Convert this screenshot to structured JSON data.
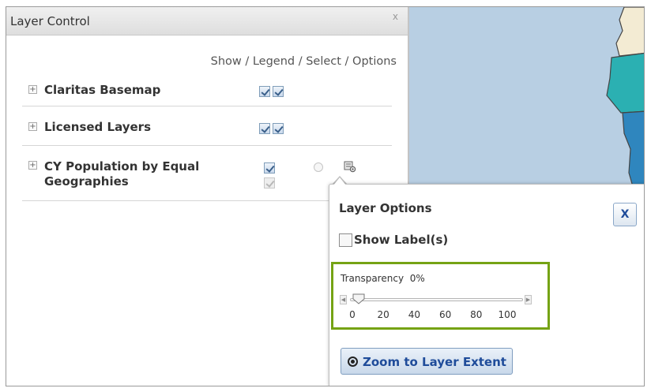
{
  "panel": {
    "title": "Layer Control",
    "close": "x",
    "columns_label": "Show / Legend / Select / Options"
  },
  "layers": [
    {
      "name": "Claritas Basemap",
      "expander": "+"
    },
    {
      "name": "Licensed Layers",
      "expander": "+"
    },
    {
      "name_line1": "CY Population by Equal",
      "name_line2": "Geographies",
      "expander": "+"
    }
  ],
  "popup": {
    "title": "Layer Options",
    "close": "X",
    "show_labels": "Show Label(s)",
    "transparency_label": "Transparency",
    "transparency_value": "0%",
    "transparency_fraction": 0,
    "ticks": [
      "0",
      "20",
      "40",
      "60",
      "80",
      "100"
    ],
    "zoom_button": "Zoom to Layer Extent"
  },
  "colors": {
    "highlight": "#75a314",
    "link_blue": "#1f4c9a",
    "map_water": "#b8cfe3",
    "map_teal": "#2bb0b2",
    "map_blue": "#2f86be"
  },
  "icons": {
    "expander": "plus-box-icon",
    "options": "options-gear-icon",
    "select": "radio-circle-icon",
    "zoom": "target-icon"
  }
}
